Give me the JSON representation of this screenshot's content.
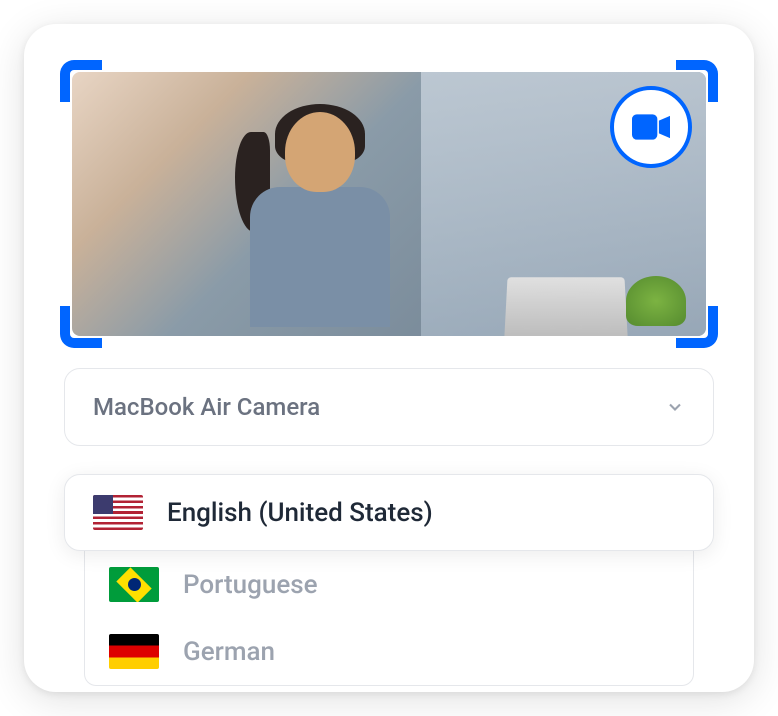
{
  "camera": {
    "selected": "MacBook Air Camera"
  },
  "languages": {
    "selected": {
      "label": "English (United States)",
      "flag": "us"
    },
    "options": [
      {
        "label": "Portuguese",
        "flag": "br"
      },
      {
        "label": "German",
        "flag": "de"
      }
    ]
  }
}
